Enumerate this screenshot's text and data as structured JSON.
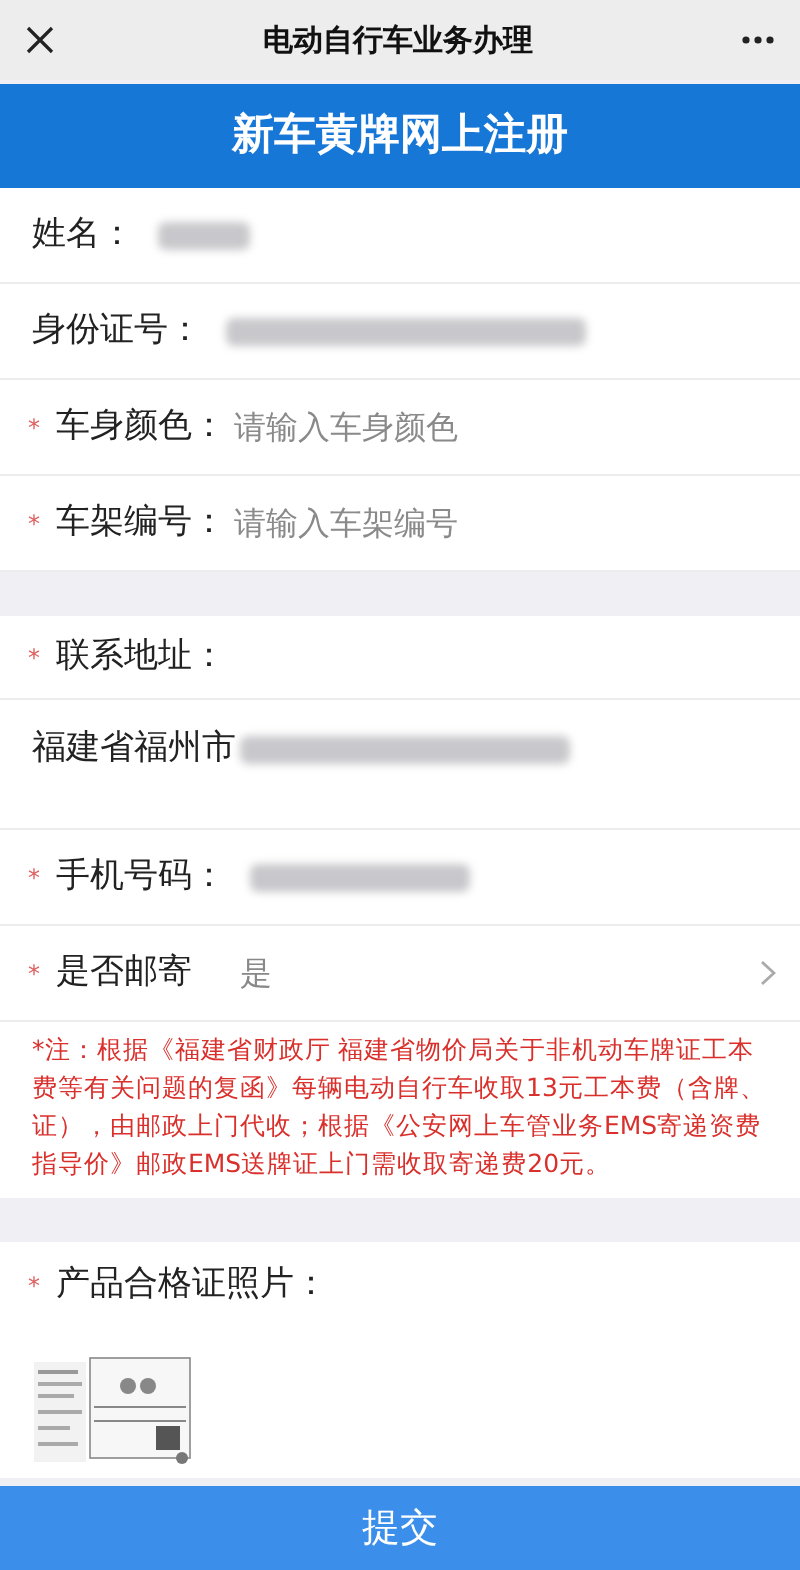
{
  "nav_bar": {
    "title": "电动自行车业务办理"
  },
  "header": {
    "title": "新车黄牌网上注册"
  },
  "sections": [
    {
      "fields": [
        {
          "kind": "text",
          "label": "姓名：",
          "value_blurred": true
        },
        {
          "kind": "text",
          "label": "身份证号：",
          "value_blurred": true
        },
        {
          "kind": "input",
          "required_mark": "*",
          "label": "车身颜色：",
          "placeholder": "请输入车身颜色"
        },
        {
          "kind": "input",
          "required_mark": "*",
          "label": "车架编号：",
          "placeholder": "请输入车架编号"
        }
      ]
    },
    {
      "fields": [
        {
          "kind": "address",
          "required_mark": "*",
          "label": "联系地址：",
          "value": "福建省福州市",
          "value_blurred": true
        },
        {
          "kind": "text",
          "required_mark": "*",
          "label": "手机号码：",
          "value_blurred": true
        },
        {
          "kind": "select",
          "required_mark": "*",
          "label": "是否邮寄",
          "value": "是"
        },
        {
          "kind": "note",
          "text": "*注：根据《福建省财政厅 福建省物价局关于非机动车牌证工本费等有关问题的复函》每辆电动自行车收取13元工本费（含牌、证），由邮政上门代收；根据《公安网上车管业务EMS寄递资费指导价》邮政EMS送牌证上门需收取寄递费20元。"
        }
      ]
    },
    {
      "fields": [
        {
          "required_mark": "*",
          "label": "产品合格证照片："
        }
      ]
    }
  ],
  "submit_button": {
    "label": "提交"
  }
}
